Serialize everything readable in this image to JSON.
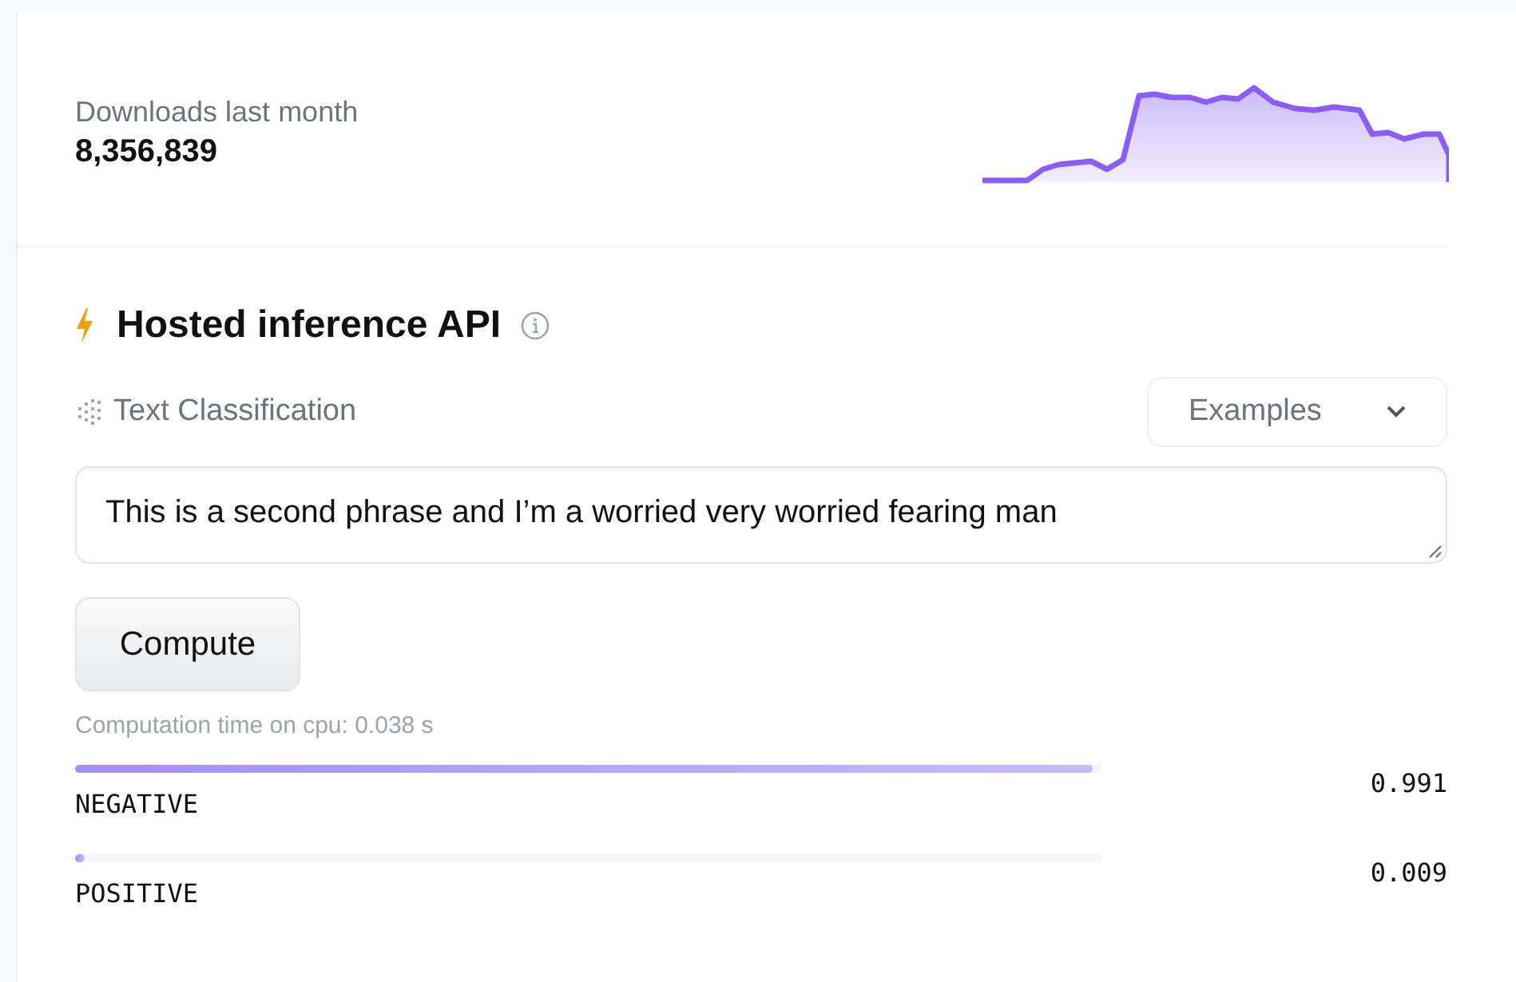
{
  "downloads": {
    "label": "Downloads last month",
    "count": "8,356,839"
  },
  "inference": {
    "title": "Hosted inference API",
    "task": "Text Classification",
    "examples": {
      "label": "Examples"
    },
    "input": {
      "value": "This is a second phrase and I’m a worried very worried fearing man"
    },
    "compute_button": "Compute",
    "computation_time": "Computation time on cpu: 0.038 s",
    "results": [
      {
        "label": "NEGATIVE",
        "score": "0.991",
        "level": 0.991
      },
      {
        "label": "POSITIVE",
        "score": "0.009",
        "level": 0.009
      }
    ]
  }
}
